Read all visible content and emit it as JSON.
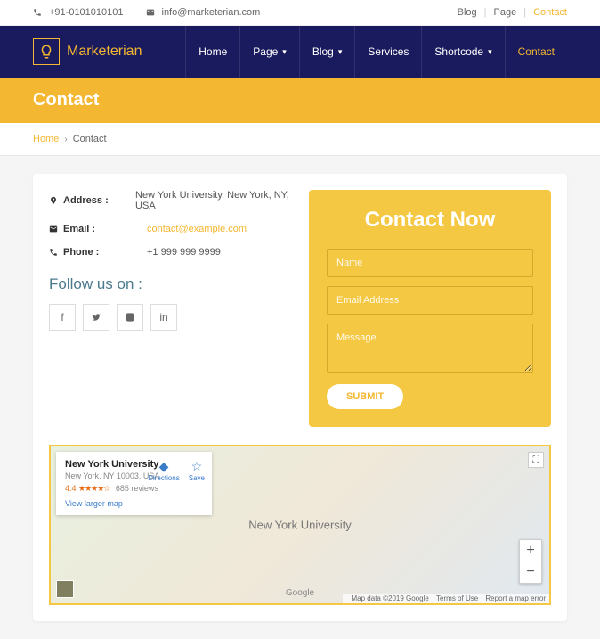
{
  "topbar": {
    "phone": "+91-0101010101",
    "email": "info@marketerian.com",
    "links": [
      "Blog",
      "Page",
      "Contact"
    ]
  },
  "brand": "Marketerian",
  "nav": {
    "items": [
      {
        "label": "Home",
        "dropdown": false
      },
      {
        "label": "Page",
        "dropdown": true
      },
      {
        "label": "Blog",
        "dropdown": true
      },
      {
        "label": "Services",
        "dropdown": false
      },
      {
        "label": "Shortcode",
        "dropdown": true
      },
      {
        "label": "Contact",
        "dropdown": false
      }
    ]
  },
  "pageTitle": "Contact",
  "breadcrumb": {
    "home": "Home",
    "current": "Contact"
  },
  "info": {
    "addressLabel": "Address :",
    "address": "New York University, New York, NY, USA",
    "emailLabel": "Email :",
    "email": "contact@example.com",
    "phoneLabel": "Phone :",
    "phone": "+1 999 999 9999"
  },
  "followTitle": "Follow us on :",
  "form": {
    "title": "Contact Now",
    "namePlaceholder": "Name",
    "emailPlaceholder": "Email Address",
    "messagePlaceholder": "Message",
    "submit": "SUBMIT"
  },
  "map": {
    "placeName": "New York University",
    "placeAddress": "New York, NY 10003, USA",
    "rating": "4.4",
    "stars": "★★★★☆",
    "reviews": "685 reviews",
    "viewLarger": "View larger map",
    "directions": "Directions",
    "save": "Save",
    "centerLabel": "New York University",
    "logo": "Google",
    "copyright": "Map data ©2019 Google",
    "terms": "Terms of Use",
    "report": "Report a map error"
  }
}
